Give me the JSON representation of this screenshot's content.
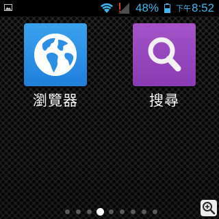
{
  "status_bar": {
    "notification_icon": "gallery-icon",
    "wifi_icon": "wifi-icon",
    "signal_icon": "signal-no-service-icon",
    "battery_percent": "48%",
    "battery_icon": "battery-icon",
    "ampm": "下午",
    "time": "8:52",
    "text_color": "#3fb6ee"
  },
  "home_screen": {
    "apps": [
      {
        "label": "瀏覽器",
        "icon": "globe-icon",
        "color": "#2b8fe6"
      },
      {
        "label": "搜尋",
        "icon": "magnifier-icon",
        "color": "#9a47bf"
      }
    ]
  },
  "page_indicator": {
    "pages": 9,
    "current": 4
  },
  "overlay": {
    "icon": "zoom-in-icon"
  }
}
